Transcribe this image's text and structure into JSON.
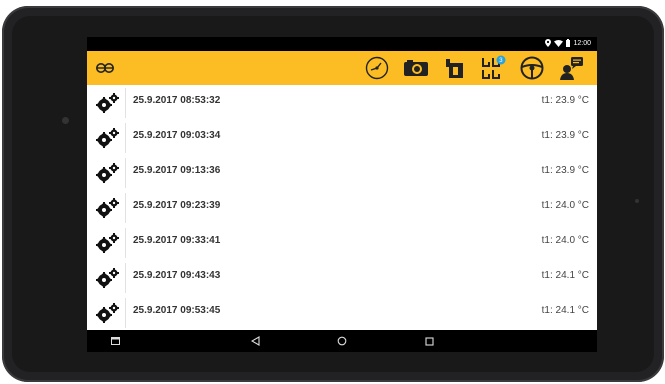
{
  "status": {
    "time": "12:00"
  },
  "toolbar": {
    "icons": [
      "app-logo-icon",
      "speedometer-icon",
      "camera-icon",
      "trailer-icon",
      "wheels-icon",
      "steering-wheel-icon",
      "driver-message-icon"
    ],
    "badge_color": "#2ea3d9",
    "accent": "#fbbd23"
  },
  "list": {
    "rows": [
      {
        "time": "25.9.2017 08:53:32",
        "temp": "t1: 23.9 °C"
      },
      {
        "time": "25.9.2017 09:03:34",
        "temp": "t1: 23.9 °C"
      },
      {
        "time": "25.9.2017 09:13:36",
        "temp": "t1: 23.9 °C"
      },
      {
        "time": "25.9.2017 09:23:39",
        "temp": "t1: 24.0 °C"
      },
      {
        "time": "25.9.2017 09:33:41",
        "temp": "t1: 24.0 °C"
      },
      {
        "time": "25.9.2017 09:43:43",
        "temp": "t1: 24.1 °C"
      },
      {
        "time": "25.9.2017 09:53:45",
        "temp": "t1: 24.1 °C"
      }
    ]
  },
  "navbar": {
    "icons": [
      "recents-icon",
      "back-icon",
      "home-icon",
      "overview-icon"
    ]
  }
}
